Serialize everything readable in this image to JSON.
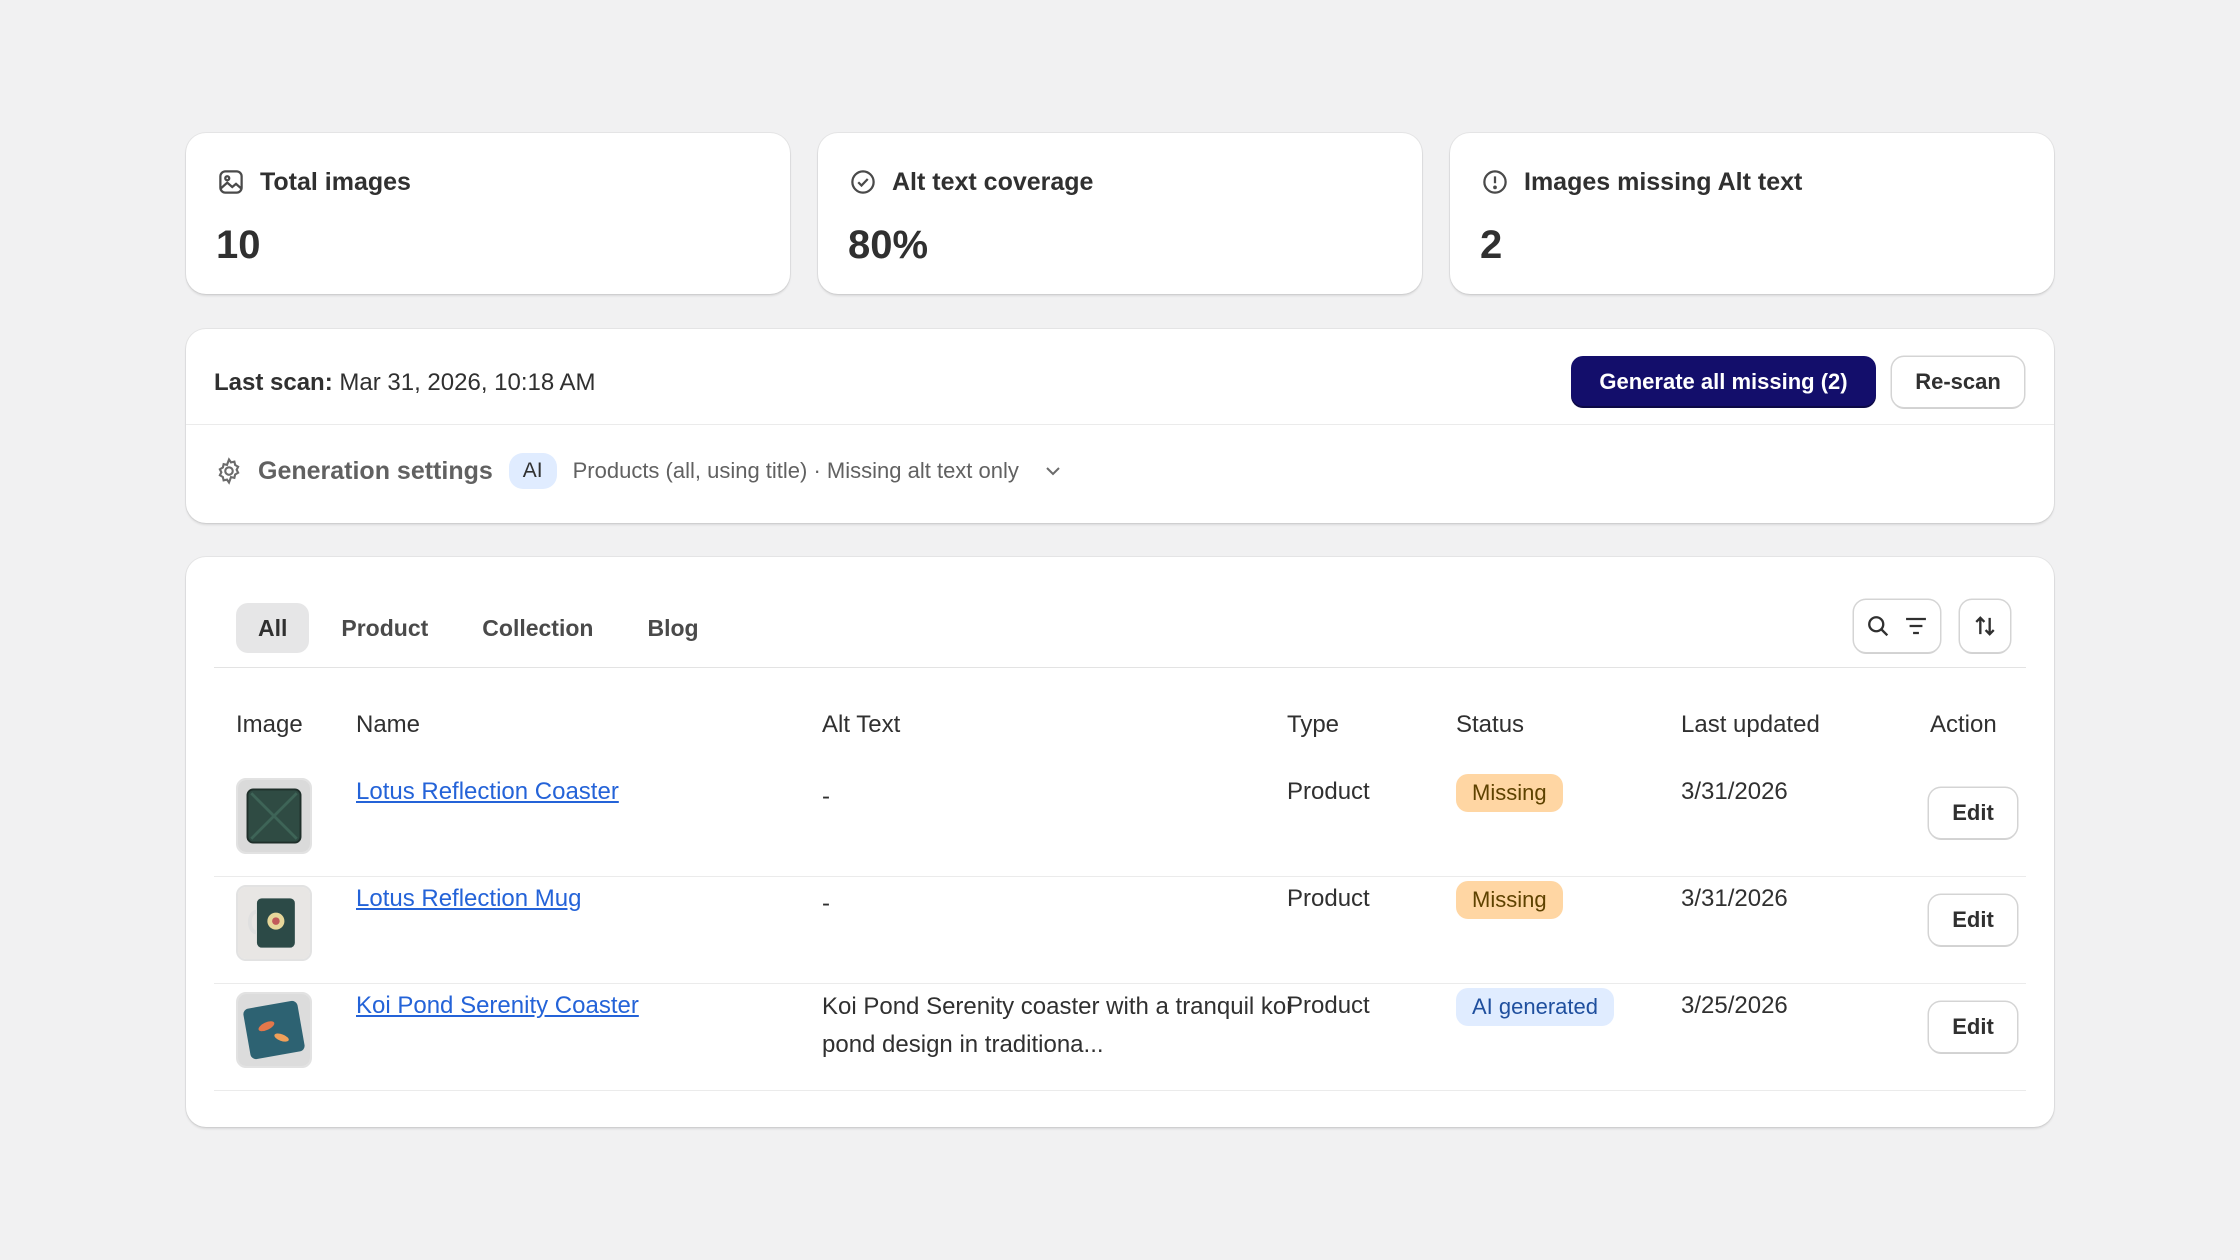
{
  "stats": [
    {
      "label": "Total images",
      "value": "10",
      "icon": "image-icon"
    },
    {
      "label": "Alt text coverage",
      "value": "80%",
      "icon": "check-circle-icon"
    },
    {
      "label": "Images missing Alt text",
      "value": "2",
      "icon": "alert-circle-icon"
    }
  ],
  "scan": {
    "last_scan_label": "Last scan:",
    "last_scan_value": "Mar 31, 2026, 10:18 AM",
    "generate_label": "Generate all missing (2)",
    "rescan_label": "Re-scan"
  },
  "generation": {
    "label": "Generation settings",
    "pill": "AI",
    "description": "Products (all, using title) · Missing alt text only"
  },
  "tabs": [
    {
      "label": "All",
      "active": true
    },
    {
      "label": "Product",
      "active": false
    },
    {
      "label": "Collection",
      "active": false
    },
    {
      "label": "Blog",
      "active": false
    }
  ],
  "columns": {
    "image": "Image",
    "name": "Name",
    "alt": "Alt Text",
    "type": "Type",
    "status": "Status",
    "updated": "Last updated",
    "action": "Action"
  },
  "rows": [
    {
      "name": "Lotus Reflection Coaster",
      "alt": "-",
      "type": "Product",
      "status": "Missing",
      "updated": "3/31/2026",
      "action": "Edit"
    },
    {
      "name": "Lotus Reflection Mug",
      "alt": "-",
      "type": "Product",
      "status": "Missing",
      "updated": "3/31/2026",
      "action": "Edit"
    },
    {
      "name": "Koi Pond Serenity Coaster",
      "alt": "Koi Pond Serenity coaster with a tranquil koi pond design in traditiona...",
      "type": "Product",
      "status": "AI generated",
      "updated": "3/25/2026",
      "action": "Edit"
    }
  ],
  "colors": {
    "primary_button": "#130e6b",
    "link": "#2463d8",
    "missing_badge": "#ffd6a3",
    "ai_badge": "#e0ecff",
    "background": "#f1f1f2"
  }
}
